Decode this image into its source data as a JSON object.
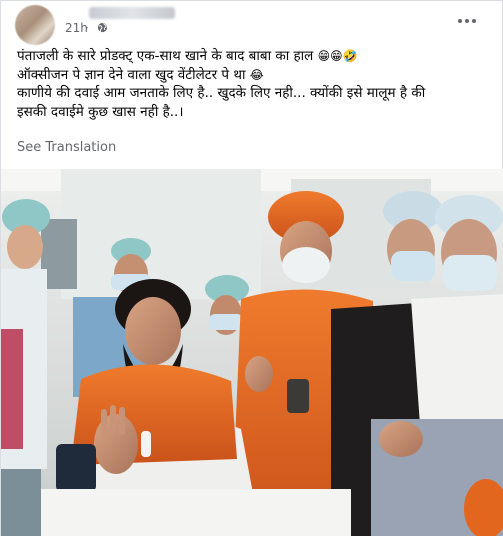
{
  "post": {
    "timestamp": "21h",
    "separator": "·",
    "text_lines": [
      "पंताजली के सारे प्रोडक्ट् एक-साथ खाने के बाद बाबा का हाल",
      "ऑक्सीजन पे ज्ञान देने वाला खुद वेंटीलेटर पे था",
      "काणीये की दवाई आम जनताके लिए है.. खुदके लिए नही... क्योंकी इसे मालूम है की",
      "इसकी दवाईमे कुछ खास नही है..।"
    ],
    "emoji_line1": "😁😁🤣",
    "emoji_line2": "😂",
    "see_translation": "See Translation"
  },
  "icons": {
    "globe": "globe-icon",
    "more": "more-options-icon"
  },
  "colors": {
    "text": "#050505",
    "meta": "#65676b",
    "saffron_robe": "#e0651f",
    "mask_blue": "#cfe4ee"
  }
}
